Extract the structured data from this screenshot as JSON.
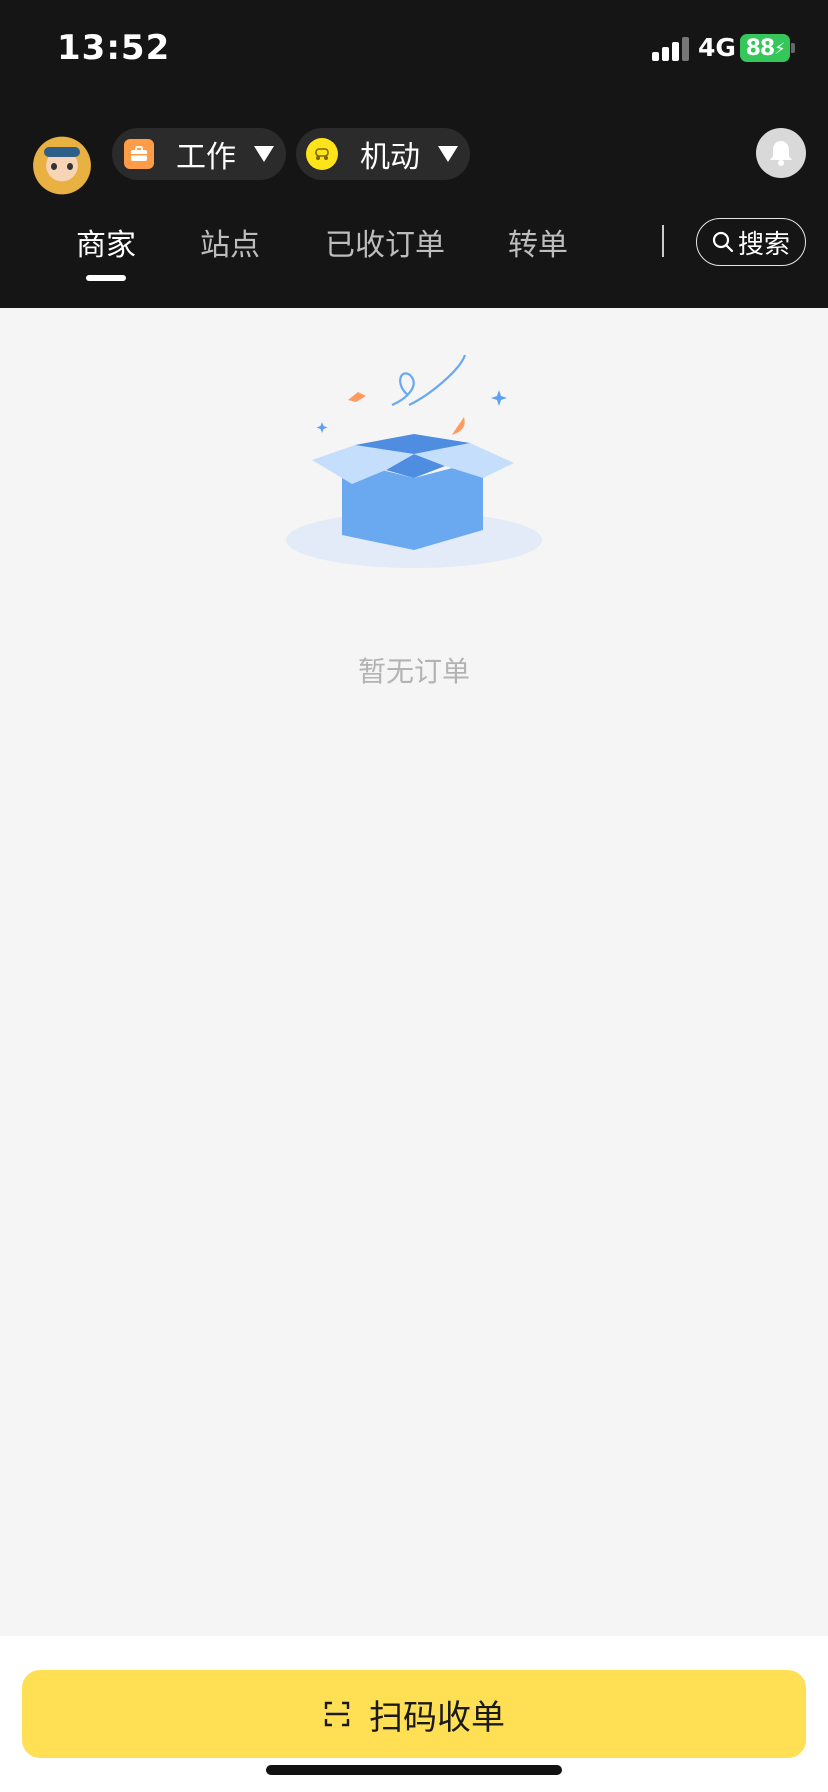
{
  "status_bar": {
    "time": "13:52",
    "network": "4G",
    "battery": "88"
  },
  "top_bar": {
    "work_selector": {
      "label": "工作",
      "icon": "briefcase-icon"
    },
    "mode_selector": {
      "label": "机动",
      "icon": "scooter-icon"
    },
    "notification": {
      "icon": "bell-icon"
    }
  },
  "tabs": [
    {
      "label": "商家",
      "active": true
    },
    {
      "label": "站点",
      "active": false
    },
    {
      "label": "已收订单",
      "active": false
    },
    {
      "label": "转单",
      "active": false
    }
  ],
  "search": {
    "label": "搜索",
    "icon": "search-icon"
  },
  "empty_state": {
    "text": "暂无订单",
    "icon": "open-box-icon"
  },
  "bottom": {
    "scan_label": "扫码收单",
    "icon": "scan-icon"
  },
  "colors": {
    "header_bg": "#151515",
    "accent_yellow": "#ffdf53",
    "battery_green": "#35c759",
    "box_blue": "#6aa9ef"
  }
}
